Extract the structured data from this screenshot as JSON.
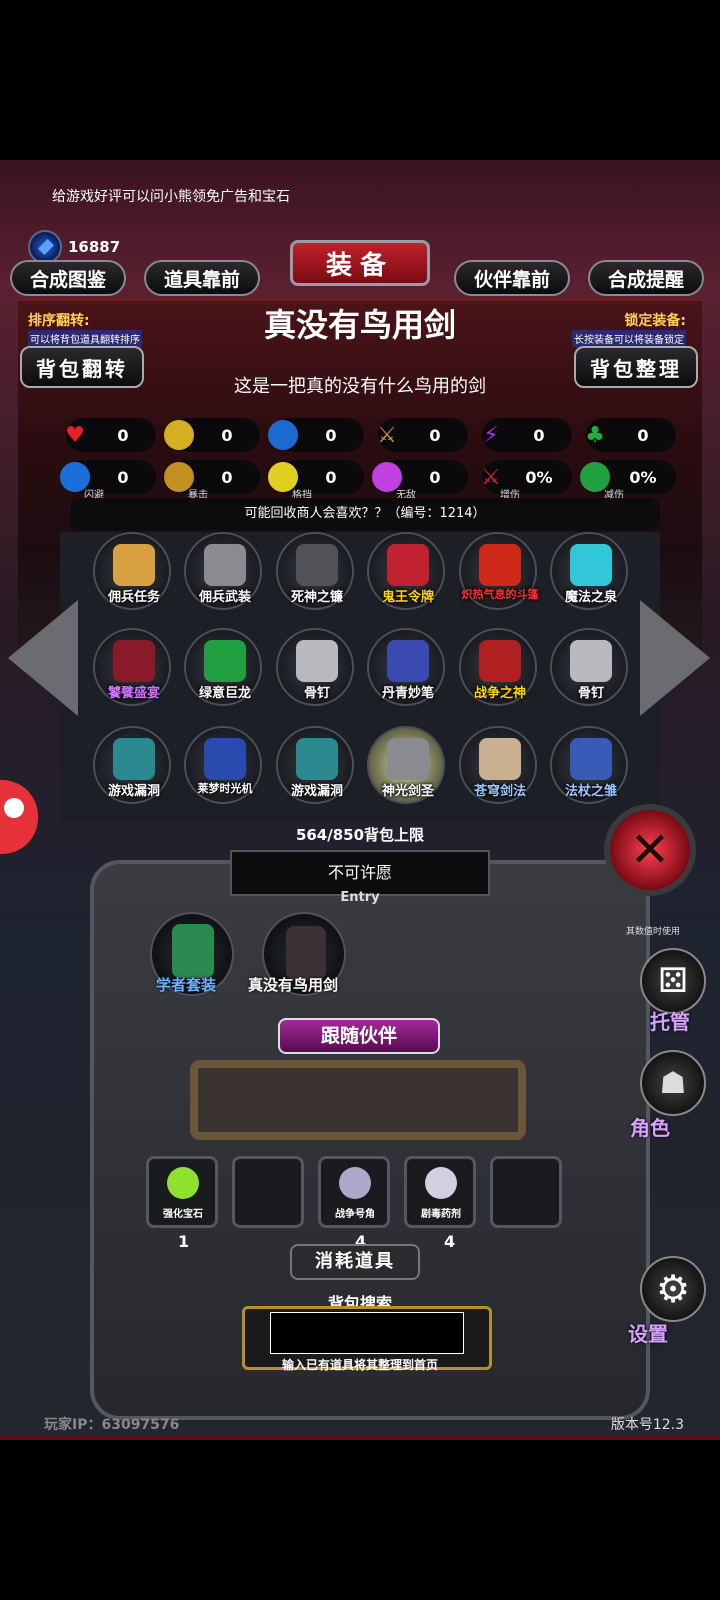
{
  "tip": "给游戏好评可以问小熊领免广告和宝石",
  "gems": "16887",
  "title": "装备",
  "tabs": [
    "合成图鉴",
    "道具靠前",
    "伙伴靠前",
    "合成提醒"
  ],
  "sort_flip": {
    "label": "排序翻转:",
    "desc": "可以将背包道具翻转排序"
  },
  "lock_equip": {
    "label": "锁定装备:",
    "desc": "长按装备可以将装备锁定"
  },
  "item": {
    "name": "真没有鸟用剑",
    "desc": "这是一把真的没有什么鸟用的剑"
  },
  "buttons": {
    "bag_flip": "背包翻转",
    "bag_sort": "背包整理"
  },
  "stats": [
    {
      "icon": "heart-icon",
      "value": "0",
      "label": ""
    },
    {
      "icon": "armor-icon",
      "value": "0",
      "label": ""
    },
    {
      "icon": "boot-icon",
      "value": "0",
      "label": ""
    },
    {
      "icon": "sword-icon",
      "value": "0",
      "label": ""
    },
    {
      "icon": "lightning-icon",
      "value": "0",
      "label": ""
    },
    {
      "icon": "clover-icon",
      "value": "0",
      "label": ""
    },
    {
      "icon": "dodge-icon",
      "value": "0",
      "label": "闪避"
    },
    {
      "icon": "crit-icon",
      "value": "0",
      "label": "暴击"
    },
    {
      "icon": "shield-icon",
      "value": "0",
      "label": "格挡"
    },
    {
      "icon": "wings-icon",
      "value": "0",
      "label": "无敌"
    },
    {
      "icon": "damage-up-icon",
      "value": "0%",
      "label": "增伤"
    },
    {
      "icon": "damage-down-icon",
      "value": "0%",
      "label": "减伤"
    }
  ],
  "recycle": "可能回收商人会喜欢？？（编号：1214）",
  "bag_items": [
    {
      "name": "佣兵任务",
      "color": "#ffffff"
    },
    {
      "name": "佣兵武装",
      "color": "#ffffff"
    },
    {
      "name": "死神之镰",
      "color": "#ffffff"
    },
    {
      "name": "鬼王令牌",
      "color": "#ffd700"
    },
    {
      "name": "炽热气息的斗篷",
      "color": "#ff3030"
    },
    {
      "name": "魔法之泉",
      "color": "#ffffff"
    },
    {
      "name": "饕餮盛宴",
      "color": "#d070ff"
    },
    {
      "name": "绿意巨龙",
      "color": "#ffffff"
    },
    {
      "name": "骨钉",
      "color": "#ffffff"
    },
    {
      "name": "丹青妙笔",
      "color": "#ffffff"
    },
    {
      "name": "战争之神",
      "color": "#ffd700"
    },
    {
      "name": "骨钉",
      "color": "#ffffff"
    },
    {
      "name": "游戏漏洞",
      "color": "#ffffff"
    },
    {
      "name": "莱梦时光机",
      "color": "#ffffff"
    },
    {
      "name": "游戏漏洞",
      "color": "#ffffff"
    },
    {
      "name": "神光剑圣",
      "color": "#ffffff"
    },
    {
      "name": "苍穹剑法",
      "color": "#9ec8ff"
    },
    {
      "name": "法杖之雏",
      "color": "#9ec8ff"
    }
  ],
  "capacity": "564/850背包上限",
  "wish": {
    "title": "不可许愿",
    "sub": "Entry"
  },
  "equipped": [
    {
      "name": "学者套装",
      "color": "#6fb0ff"
    },
    {
      "name": "真没有鸟用剑",
      "color": "#ffffff"
    }
  ],
  "follow_partner": "跟随伙伴",
  "consumables": [
    {
      "name": "强化宝石",
      "count": "1"
    },
    {
      "name": "",
      "count": ""
    },
    {
      "name": "战争号角",
      "count": "4"
    },
    {
      "name": "剧毒药剂",
      "count": "4"
    },
    {
      "name": "",
      "count": ""
    }
  ],
  "consumables_title": "消耗道具",
  "search": {
    "label": "背包搜索",
    "placeholder": "",
    "hint": "输入已有道具将其整理到首页"
  },
  "side": {
    "stat_sub": "其数值时使用",
    "manage": "托管",
    "role": "角色",
    "settings": "设置"
  },
  "footer": {
    "ip": "玩家IP：63097576",
    "version": "版本号12.3"
  },
  "colors": {
    "accent": "#c0202a",
    "gold": "#ffd05a",
    "purple": "#a22a9a"
  }
}
